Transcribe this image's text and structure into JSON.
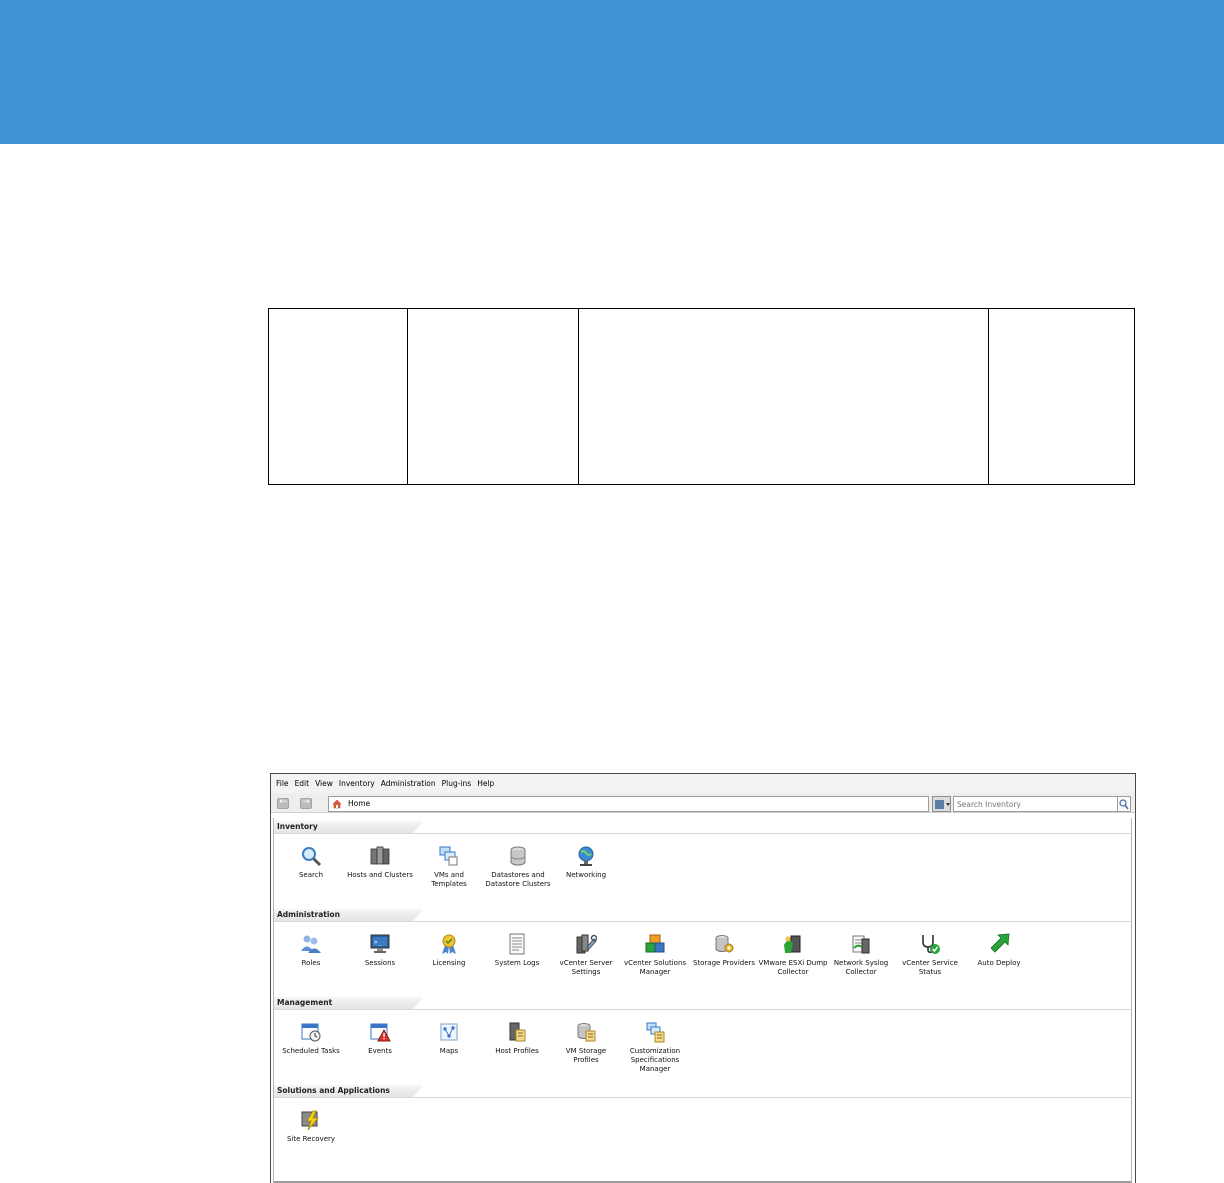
{
  "menubar": {
    "items": [
      "File",
      "Edit",
      "View",
      "Inventory",
      "Administration",
      "Plug-ins",
      "Help"
    ]
  },
  "toolbar": {
    "back_icon": "back-arrow-icon",
    "forward_icon": "forward-arrow-icon",
    "address": "Home",
    "search_placeholder": "Search Inventory"
  },
  "sections": [
    {
      "title": "Inventory",
      "items": [
        {
          "label": "Search",
          "icon": "magnifier-icon"
        },
        {
          "label": "Hosts and Clusters",
          "icon": "hosts-clusters-icon"
        },
        {
          "label": "VMs and\nTemplates",
          "icon": "vms-templates-icon"
        },
        {
          "label": "Datastores and\nDatastore Clusters",
          "icon": "datastore-icon"
        },
        {
          "label": "Networking",
          "icon": "network-globe-icon"
        }
      ]
    },
    {
      "title": "Administration",
      "items": [
        {
          "label": "Roles",
          "icon": "roles-users-icon"
        },
        {
          "label": "Sessions",
          "icon": "sessions-monitor-icon"
        },
        {
          "label": "Licensing",
          "icon": "licensing-ribbon-icon"
        },
        {
          "label": "System Logs",
          "icon": "system-logs-icon"
        },
        {
          "label": "vCenter Server\nSettings",
          "icon": "server-settings-icon"
        },
        {
          "label": "vCenter Solutions\nManager",
          "icon": "solutions-manager-icon"
        },
        {
          "label": "Storage Providers",
          "icon": "storage-providers-icon"
        },
        {
          "label": "VMware ESXi Dump\nCollector",
          "icon": "dump-collector-icon"
        },
        {
          "label": "Network Syslog\nCollector",
          "icon": "syslog-collector-icon"
        },
        {
          "label": "vCenter Service\nStatus",
          "icon": "service-status-icon"
        },
        {
          "label": "Auto Deploy",
          "icon": "auto-deploy-arrow-icon"
        }
      ]
    },
    {
      "title": "Management",
      "items": [
        {
          "label": "Scheduled Tasks",
          "icon": "scheduled-tasks-icon"
        },
        {
          "label": "Events",
          "icon": "events-warning-icon"
        },
        {
          "label": "Maps",
          "icon": "maps-icon"
        },
        {
          "label": "Host Profiles",
          "icon": "host-profiles-icon"
        },
        {
          "label": "VM Storage\nProfiles",
          "icon": "vm-storage-profiles-icon"
        },
        {
          "label": "Customization\nSpecifications\nManager",
          "icon": "customization-specs-icon"
        }
      ]
    },
    {
      "title": "Solutions and Applications",
      "items": [
        {
          "label": "Site Recovery",
          "icon": "site-recovery-bolt-icon"
        }
      ]
    }
  ],
  "colors": {
    "banner": "#4193d8",
    "section_header": "#e6e6e6",
    "accent_green": "#2aa33a",
    "accent_blue": "#3a77c9"
  }
}
